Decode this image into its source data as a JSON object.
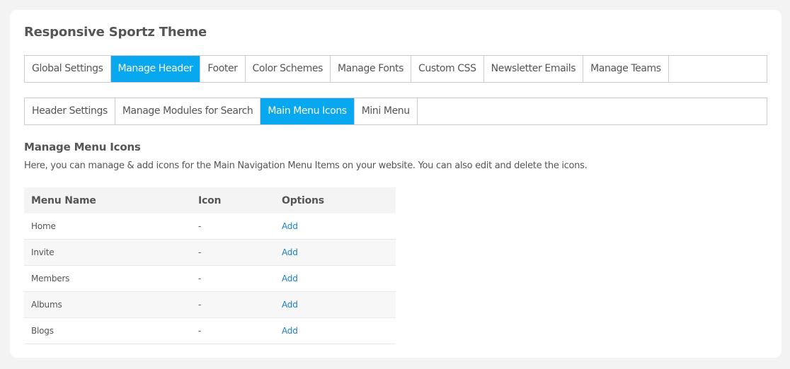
{
  "page": {
    "title": "Responsive Sportz Theme"
  },
  "main_tabs": [
    {
      "label": "Global Settings",
      "active": false
    },
    {
      "label": "Manage Header",
      "active": true
    },
    {
      "label": "Footer",
      "active": false
    },
    {
      "label": "Color Schemes",
      "active": false
    },
    {
      "label": "Manage Fonts",
      "active": false
    },
    {
      "label": "Custom CSS",
      "active": false
    },
    {
      "label": "Newsletter Emails",
      "active": false
    },
    {
      "label": "Manage Teams",
      "active": false
    }
  ],
  "sub_tabs": [
    {
      "label": "Header Settings",
      "active": false
    },
    {
      "label": "Manage Modules for Search",
      "active": false
    },
    {
      "label": "Main Menu Icons",
      "active": true
    },
    {
      "label": "Mini Menu",
      "active": false
    }
  ],
  "section": {
    "title": "Manage Menu Icons",
    "description": "Here, you can manage & add icons for the Main Navigation Menu Items on your website. You can also edit and delete the icons."
  },
  "table": {
    "headers": [
      "Menu Name",
      "Icon",
      "Options"
    ],
    "rows": [
      {
        "name": "Home",
        "icon": "-",
        "option": "Add"
      },
      {
        "name": "Invite",
        "icon": "-",
        "option": "Add"
      },
      {
        "name": "Members",
        "icon": "-",
        "option": "Add"
      },
      {
        "name": "Albums",
        "icon": "-",
        "option": "Add"
      },
      {
        "name": "Blogs",
        "icon": "-",
        "option": "Add"
      }
    ]
  },
  "colors": {
    "active_tab": "#08a8f0",
    "link": "#1a7fc4"
  }
}
